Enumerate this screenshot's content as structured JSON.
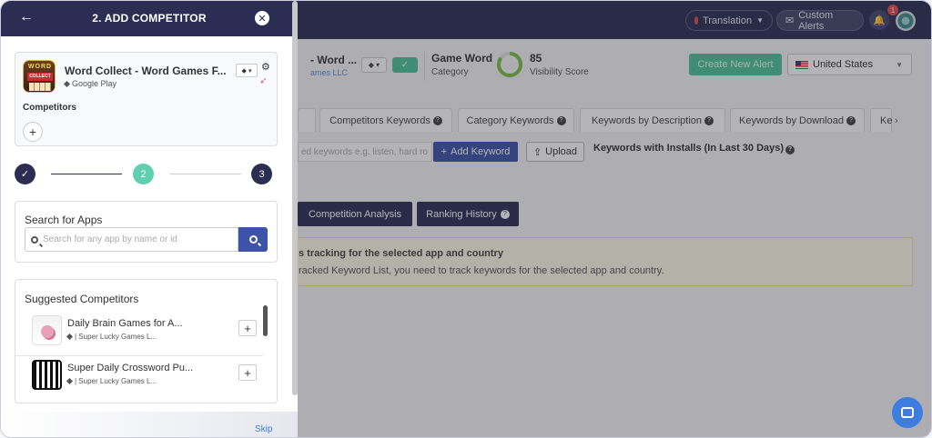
{
  "topbar": {
    "translation_label": "Translation",
    "custom_alerts_label": "Custom Alerts",
    "notification_count": "1"
  },
  "app_header": {
    "app_title": "- Word ...",
    "developer": "ames LLC",
    "category_name": "Game Word",
    "category_label": "Category",
    "visibility_score": "85",
    "visibility_label": "Visibility Score",
    "create_alert_label": "Create New Alert",
    "country": "United States"
  },
  "tabs": [
    {
      "label": "Competitors Keywords"
    },
    {
      "label": "Category Keywords"
    },
    {
      "label": "Keywords by Description"
    },
    {
      "label": "Keywords by Download"
    },
    {
      "label": "Ke"
    }
  ],
  "keyword_bar": {
    "input_placeholder": "ed keywords e.g. listen, hard ro",
    "add_keyword_label": "Add Keyword",
    "upload_label": "Upload",
    "installs_label": "Keywords with Installs (In Last 30 Days)"
  },
  "data_tabs": {
    "competition_analysis": "Competition Analysis",
    "ranking_history": "Ranking History"
  },
  "notice": {
    "title": "s tracking for the selected app and country",
    "body": "racked Keyword List, you need to track keywords for the selected app and country."
  },
  "panel": {
    "title": "2. ADD COMPETITOR",
    "app": {
      "name": "Word Collect - Word Games F...",
      "store": "Google Play",
      "icon_text_top": "WORD",
      "icon_text_mid": "COLLECT"
    },
    "competitors_label": "Competitors",
    "steps": [
      "2",
      "3"
    ],
    "search": {
      "title": "Search for Apps",
      "placeholder": "Search for any app by name or id"
    },
    "suggested": {
      "title": "Suggested Competitors",
      "items": [
        {
          "name": "Daily Brain Games for A...",
          "developer": "| Super Lucky Games L..."
        },
        {
          "name": "Super Daily Crossword Pu...",
          "developer": "| Super Lucky Games L..."
        }
      ]
    },
    "skip_label": "Skip"
  },
  "colors": {
    "navy": "#2b2d52",
    "accent_green": "#4cc496",
    "step_active": "#5fcfb0",
    "button_blue": "#3c53a8",
    "link_blue": "#3c7de0"
  }
}
